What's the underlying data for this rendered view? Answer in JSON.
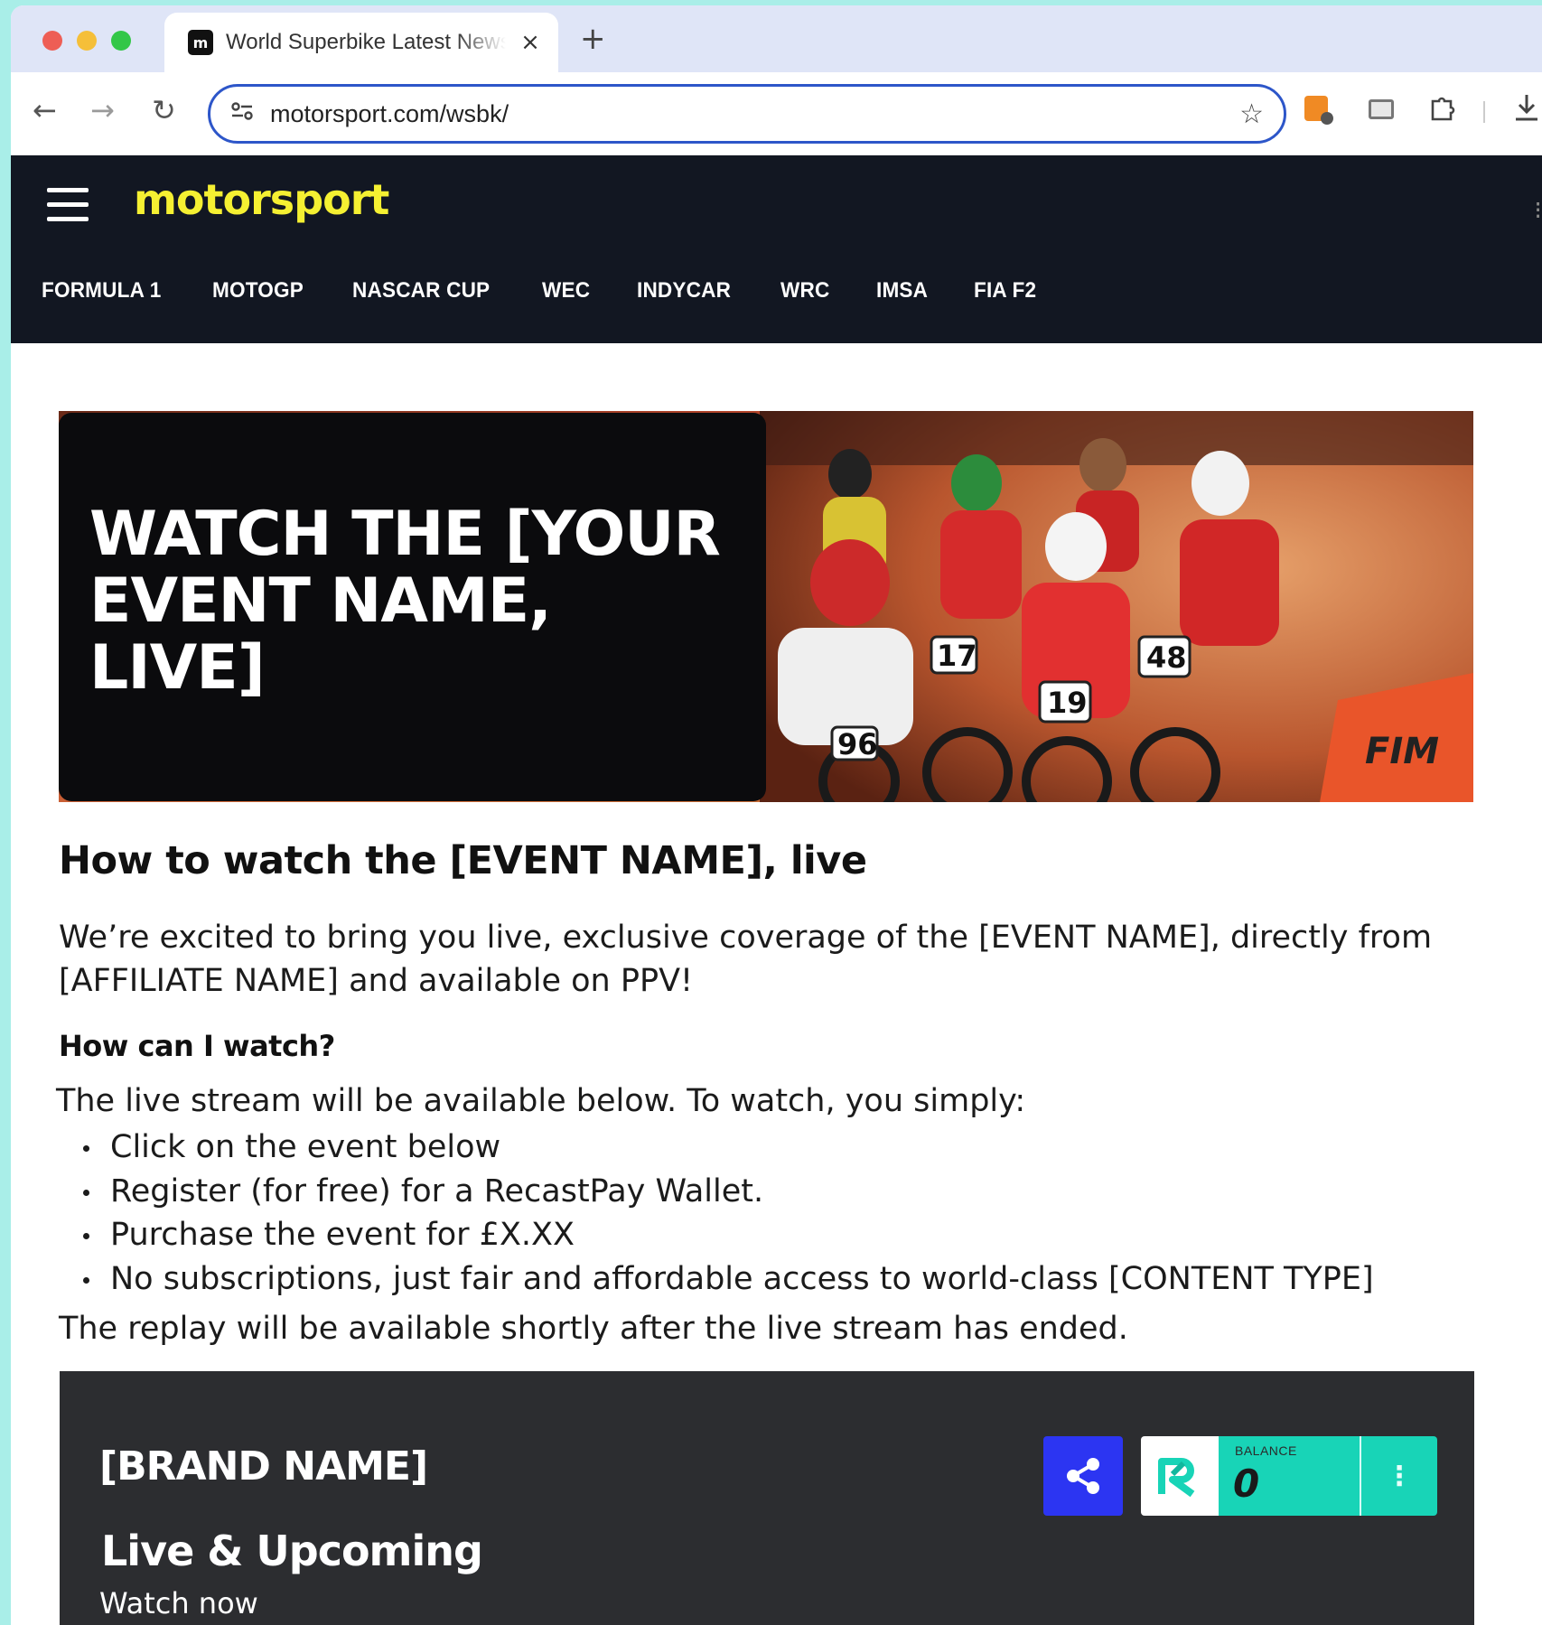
{
  "browser": {
    "tab_title": "World Superbike Latest News",
    "tab_close": "×",
    "new_tab": "+",
    "favicon_letter": "m",
    "url": "motorsport.com/wsbk/",
    "icons": [
      "back-icon",
      "forward-icon",
      "reload-icon",
      "site-settings-icon",
      "bookmark-star-icon",
      "extension-icon",
      "cast-icon",
      "puzzle-icon",
      "download-icon"
    ]
  },
  "site": {
    "logo": "motorsport",
    "nav": [
      "FORMULA 1",
      "MOTOGP",
      "NASCAR CUP",
      "WEC",
      "INDYCAR",
      "WRC",
      "IMSA",
      "FIA F2"
    ],
    "brand_accent": "#f5f032",
    "header_bg": "#121722"
  },
  "hero": {
    "title": "WATCH THE [YOUR EVENT NAME, LIVE]",
    "image_description_icon": "motocross-riders-image",
    "image_labels": [
      "17",
      "19",
      "48",
      "96",
      "FIM"
    ]
  },
  "article": {
    "title": "How to watch the [EVENT NAME], live",
    "intro": "We’re excited to bring you live, exclusive coverage of the [EVENT NAME], directly from [AFFILIATE NAME] and available on PPV!",
    "subhead": "How can I watch?",
    "step_intro": "The live stream will be available below. To watch, you simply:",
    "steps": [
      "Click on the event below",
      "Register (for free) for a RecastPay Wallet.",
      "Purchase the event for £X.XX",
      "No subscriptions, just fair and affordable access to world-class [CONTENT TYPE]"
    ],
    "replay": "The replay will be available shortly after the live stream has ended."
  },
  "widget": {
    "brand": "[BRAND NAME]",
    "heading": "Live & Upcoming",
    "subheading": "Watch now",
    "balance_label": "BALANCE",
    "balance_value": "0",
    "accent_share": "#2c35f2",
    "accent_wallet": "#18d4b7"
  }
}
